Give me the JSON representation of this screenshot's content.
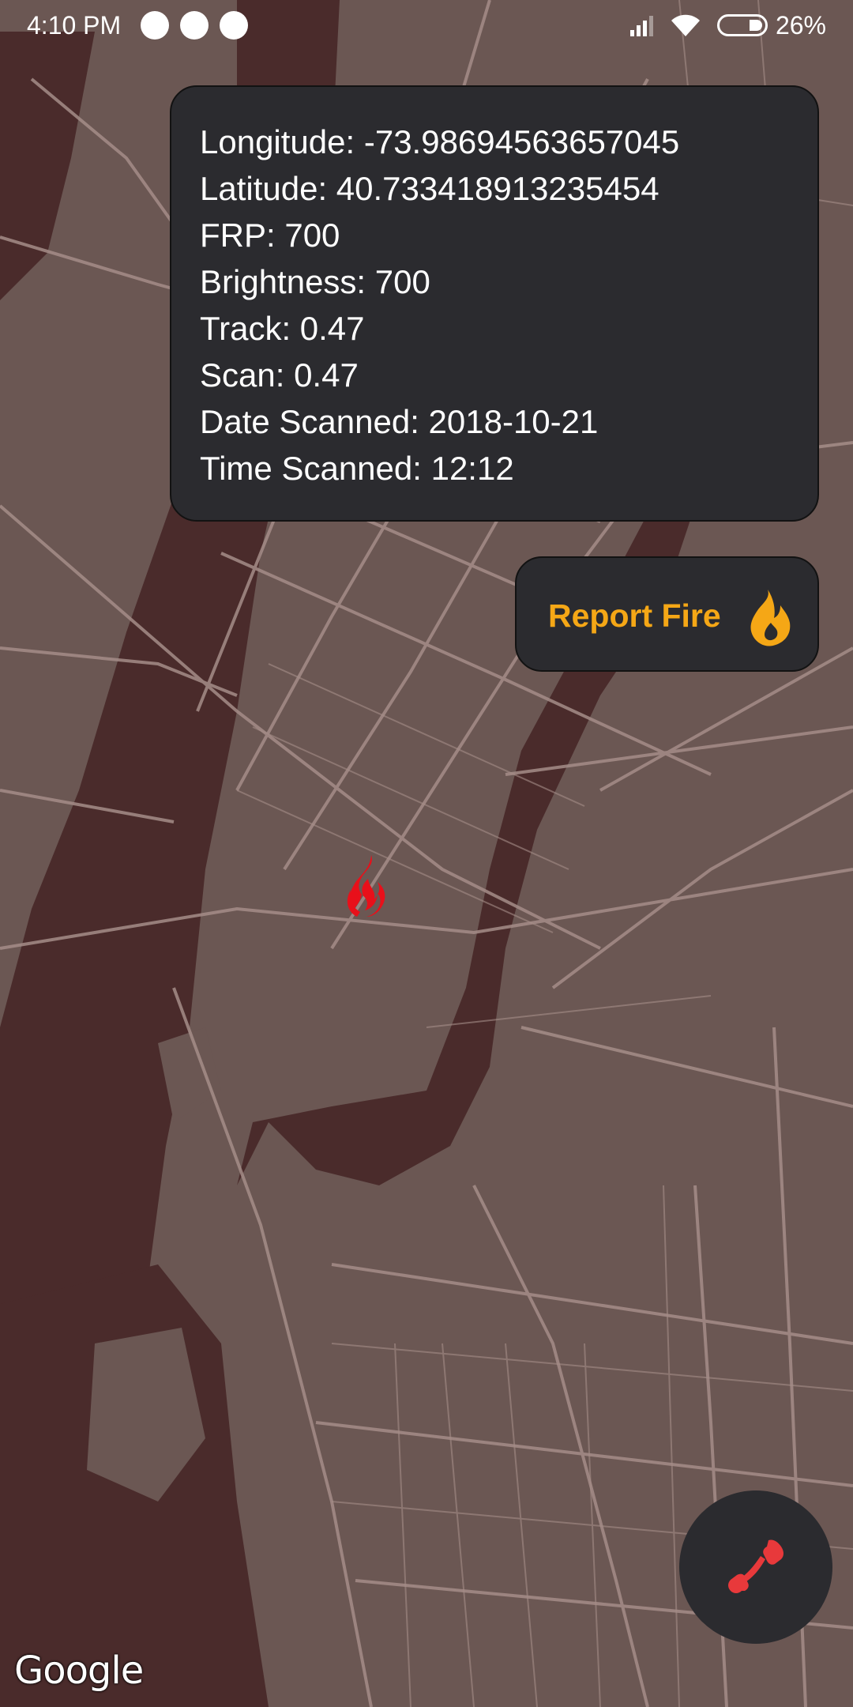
{
  "status_bar": {
    "time": "4:10 PM",
    "battery_percent": "26%",
    "notification_icons": [
      "app-a-icon",
      "app-a-icon",
      "messenger-icon"
    ]
  },
  "info_card": {
    "longitude": "Longitude: -73.98694563657045",
    "latitude": "Latitude: 40.733418913235454",
    "frp": "FRP: 700",
    "brightness": "Brightness: 700",
    "track": "Track: 0.47",
    "scan": "Scan: 0.47",
    "date_scanned": "Date Scanned: 2018-10-21",
    "time_scanned": "Time Scanned: 12:12"
  },
  "report_button": {
    "label": "Report Fire",
    "icon": "flame-icon",
    "color": "#f5a716"
  },
  "map": {
    "marker_icon": "fire-marker-icon",
    "marker_color": "#e8101a",
    "attribution": "Google",
    "land_color": "#6b5753",
    "water_color": "#4a2b2b",
    "road_color": "#a58d88"
  },
  "call_button": {
    "icon": "phone-icon",
    "icon_color": "#e8393b"
  }
}
